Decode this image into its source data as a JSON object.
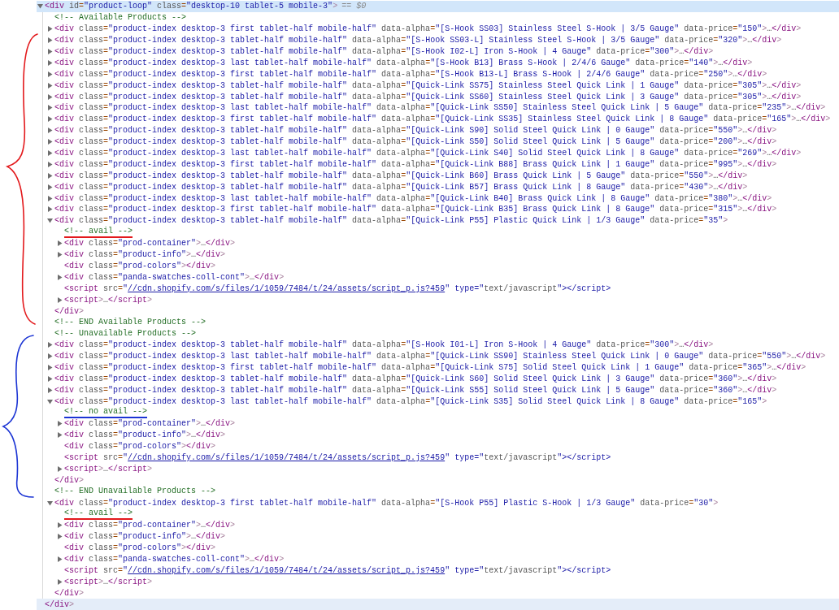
{
  "annotations": [
    {
      "kind": "brace",
      "color": "#e3191c"
    },
    {
      "kind": "brace",
      "color": "#1b34d4"
    }
  ],
  "dom_tree": {
    "kind": "element",
    "text": "<div id=\"product-loop\" class=\"desktop-10 tablet-5 mobile-3\">",
    "expanded": true,
    "selected": true,
    "console_ref": "== $0",
    "close": "</div>",
    "children": [
      {
        "kind": "comment",
        "text": "<!-- Available Products -->",
        "selected": false
      },
      {
        "kind": "element",
        "text": "<div class=\"product-index desktop-3 first tablet-half mobile-half\" data-alpha=\"[S-Hook SS03] Stainless Steel S-Hook | 3/5 Gauge\" data-price=\"150\">…</div>",
        "expanded": false,
        "selected": false
      },
      {
        "kind": "element",
        "text": "<div class=\"product-index desktop-3 tablet-half mobile-half\" data-alpha=\"[S-Hook SS03-L] Stainless Steel S-Hook | 3/5 Gauge\" data-price=\"320\">…</div>",
        "expanded": false,
        "selected": false
      },
      {
        "kind": "element",
        "text": "<div class=\"product-index desktop-3 tablet-half mobile-half\" data-alpha=\"[S-Hook I02-L] Iron S-Hook | 4 Gauge\" data-price=\"300\">…</div>",
        "expanded": false,
        "selected": false
      },
      {
        "kind": "element",
        "text": "<div class=\"product-index desktop-3 last tablet-half mobile-half\" data-alpha=\"[S-Hook B13] Brass S-Hook | 2/4/6 Gauge\" data-price=\"140\">…</div>",
        "expanded": false,
        "selected": false
      },
      {
        "kind": "element",
        "text": "<div class=\"product-index desktop-3 first tablet-half mobile-half\" data-alpha=\"[S-Hook B13-L] Brass S-Hook | 2/4/6 Gauge\" data-price=\"250\">…</div>",
        "expanded": false,
        "selected": false
      },
      {
        "kind": "element",
        "text": "<div class=\"product-index desktop-3 tablet-half mobile-half\" data-alpha=\"[Quick-Link SS75] Stainless Steel Quick Link | 1 Gauge\" data-price=\"305\">…</div>",
        "expanded": false,
        "selected": false
      },
      {
        "kind": "element",
        "text": "<div class=\"product-index desktop-3 tablet-half mobile-half\" data-alpha=\"[Quick-Link SS60] Stainless Steel Quick Link | 3 Gauge\" data-price=\"305\">…</div>",
        "expanded": false,
        "selected": false
      },
      {
        "kind": "element",
        "text": "<div class=\"product-index desktop-3 last tablet-half mobile-half\" data-alpha=\"[Quick-Link SS50] Stainless Steel Quick Link | 5 Gauge\" data-price=\"235\">…</div>",
        "expanded": false,
        "selected": false
      },
      {
        "kind": "element",
        "text": "<div class=\"product-index desktop-3 first tablet-half mobile-half\" data-alpha=\"[Quick-Link SS35] Stainless Steel Quick Link | 8 Gauge\" data-price=\"165\">…</div>",
        "expanded": false,
        "selected": false
      },
      {
        "kind": "element",
        "text": "<div class=\"product-index desktop-3 tablet-half mobile-half\" data-alpha=\"[Quick-Link S90] Solid Steel Quick Link | 0 Gauge\" data-price=\"550\">…</div>",
        "expanded": false,
        "selected": false
      },
      {
        "kind": "element",
        "text": "<div class=\"product-index desktop-3 tablet-half mobile-half\" data-alpha=\"[Quick-Link S50] Solid Steel Quick Link | 5 Gauge\" data-price=\"200\">…</div>",
        "expanded": false,
        "selected": false
      },
      {
        "kind": "element",
        "text": "<div class=\"product-index desktop-3 last tablet-half mobile-half\" data-alpha=\"[Quick-Link S40] Solid Steel Quick Link | 8 Gauge\" data-price=\"269\">…</div>",
        "expanded": false,
        "selected": false
      },
      {
        "kind": "element",
        "text": "<div class=\"product-index desktop-3 first tablet-half mobile-half\" data-alpha=\"[Quick-Link B88] Brass Quick Link | 1 Gauge\" data-price=\"995\">…</div>",
        "expanded": false,
        "selected": false
      },
      {
        "kind": "element",
        "text": "<div class=\"product-index desktop-3 tablet-half mobile-half\" data-alpha=\"[Quick-Link B60] Brass Quick Link | 5 Gauge\" data-price=\"550\">…</div>",
        "expanded": false,
        "selected": false
      },
      {
        "kind": "element",
        "text": "<div class=\"product-index desktop-3 tablet-half mobile-half\" data-alpha=\"[Quick-Link B57] Brass Quick Link | 8 Gauge\" data-price=\"430\">…</div>",
        "expanded": false,
        "selected": false
      },
      {
        "kind": "element",
        "text": "<div class=\"product-index desktop-3 last tablet-half mobile-half\" data-alpha=\"[Quick-Link B40] Brass Quick Link | 8 Gauge\" data-price=\"380\">…</div>",
        "expanded": false,
        "selected": false
      },
      {
        "kind": "element",
        "text": "<div class=\"product-index desktop-3 first tablet-half mobile-half\" data-alpha=\"[Quick-Link B35] Brass Quick Link | 8 Gauge\" data-price=\"315\">…</div>",
        "expanded": false,
        "selected": false
      },
      {
        "kind": "element",
        "text": "<div class=\"product-index desktop-3 tablet-half mobile-half\" data-alpha=\"[Quick-Link P55] Plastic Quick Link | 1/3 Gauge\" data-price=\"35\">",
        "expanded": true,
        "selected": false,
        "close": "</div>",
        "children": [
          {
            "kind": "comment",
            "text": "<!-- avail -->",
            "color": "#e3191c",
            "selected": false
          },
          {
            "kind": "element",
            "text": "<div class=\"prod-container\">…</div>",
            "expanded": false,
            "selected": false
          },
          {
            "kind": "element",
            "text": "<div class=\"product-info\">…</div>",
            "expanded": false,
            "selected": false
          },
          {
            "kind": "element",
            "text": "<div class=\"prod-colors\"></div>",
            "selected": false
          },
          {
            "kind": "element",
            "text": "<div class=\"panda-swatches-coll-cont\">…</div>",
            "expanded": false,
            "selected": false
          },
          {
            "kind": "element",
            "parts": [
              {
                "text": "<script src=\""
              },
              {
                "text": "//cdn.shopify.com/s/files/1/1059/7484/t/24/assets/script_p.js?459",
                "link": true
              },
              {
                "text": "\" type=\"text/javascript\"></script>"
              }
            ],
            "selected": false
          },
          {
            "kind": "element",
            "text": "<script>…</script>",
            "expanded": false,
            "selected": false
          }
        ]
      },
      {
        "kind": "comment",
        "text": "<!-- END Available Products -->",
        "selected": false
      },
      {
        "kind": "comment",
        "text": "<!-- Unavailable Products -->",
        "selected": false
      },
      {
        "kind": "element",
        "text": "<div class=\"product-index desktop-3 tablet-half mobile-half\" data-alpha=\"[S-Hook I01-L] Iron S-Hook | 4 Gauge\" data-price=\"300\">…</div>",
        "expanded": false,
        "selected": false
      },
      {
        "kind": "element",
        "text": "<div class=\"product-index desktop-3 last tablet-half mobile-half\" data-alpha=\"[Quick-Link SS90] Stainless Steel Quick Link | 0 Gauge\" data-price=\"550\">…</div>",
        "expanded": false,
        "selected": false
      },
      {
        "kind": "element",
        "text": "<div class=\"product-index desktop-3 first tablet-half mobile-half\" data-alpha=\"[Quick-Link S75] Solid Steel Quick Link | 1 Gauge\" data-price=\"365\">…</div>",
        "expanded": false,
        "selected": false
      },
      {
        "kind": "element",
        "text": "<div class=\"product-index desktop-3 tablet-half mobile-half\" data-alpha=\"[Quick-Link S60] Solid Steel Quick Link | 3 Gauge\" data-price=\"360\">…</div>",
        "expanded": false,
        "selected": false
      },
      {
        "kind": "element",
        "text": "<div class=\"product-index desktop-3 tablet-half mobile-half\" data-alpha=\"[Quick-Link S55] Solid Steel Quick Link | 5 Gauge\" data-price=\"360\">…</div>",
        "expanded": false,
        "selected": false
      },
      {
        "kind": "element",
        "text": "<div class=\"product-index desktop-3 last tablet-half mobile-half\" data-alpha=\"[Quick-Link S35] Solid Steel Quick Link | 8 Gauge\" data-price=\"165\">",
        "expanded": true,
        "selected": false,
        "close": "</div>",
        "children": [
          {
            "kind": "comment",
            "text": "<!-- no avail -->",
            "color": "#1b34d4",
            "selected": false
          },
          {
            "kind": "element",
            "text": "<div class=\"prod-container\">…</div>",
            "expanded": false,
            "selected": false
          },
          {
            "kind": "element",
            "text": "<div class=\"product-info\">…</div>",
            "expanded": false,
            "selected": false
          },
          {
            "kind": "element",
            "text": "<div class=\"prod-colors\"></div>",
            "selected": false
          },
          {
            "kind": "element",
            "parts": [
              {
                "text": "<script src=\""
              },
              {
                "text": "//cdn.shopify.com/s/files/1/1059/7484/t/24/assets/script_p.js?459",
                "link": true
              },
              {
                "text": "\" type=\"text/javascript\"></script>"
              }
            ],
            "selected": false
          },
          {
            "kind": "element",
            "text": "<script>…</script>",
            "expanded": false,
            "selected": false
          }
        ]
      },
      {
        "kind": "comment",
        "text": "<!-- END Unavailable Products -->",
        "selected": false
      },
      {
        "kind": "element",
        "text": "<div class=\"product-index desktop-3 first tablet-half mobile-half\" data-alpha=\"[S-Hook P55] Plastic S-Hook | 1/3 Gauge\" data-price=\"30\">",
        "expanded": true,
        "selected": false,
        "close": "</div>",
        "children": [
          {
            "kind": "comment",
            "text": "<!-- avail -->",
            "color": "#e3191c",
            "selected": false
          },
          {
            "kind": "element",
            "text": "<div class=\"prod-container\">…</div>",
            "expanded": false,
            "selected": false
          },
          {
            "kind": "element",
            "text": "<div class=\"product-info\">…</div>",
            "expanded": false,
            "selected": false
          },
          {
            "kind": "element",
            "text": "<div class=\"prod-colors\"></div>",
            "selected": false
          },
          {
            "kind": "element",
            "text": "<div class=\"panda-swatches-coll-cont\">…</div>",
            "expanded": false,
            "selected": false
          },
          {
            "kind": "element",
            "parts": [
              {
                "text": "<script src=\""
              },
              {
                "text": "//cdn.shopify.com/s/files/1/1059/7484/t/24/assets/script_p.js?459",
                "link": true
              },
              {
                "text": "\" type=\"text/javascript\"></script>"
              }
            ],
            "selected": false
          },
          {
            "kind": "element",
            "text": "<script>…</script>",
            "expanded": false,
            "selected": false
          }
        ]
      }
    ]
  }
}
